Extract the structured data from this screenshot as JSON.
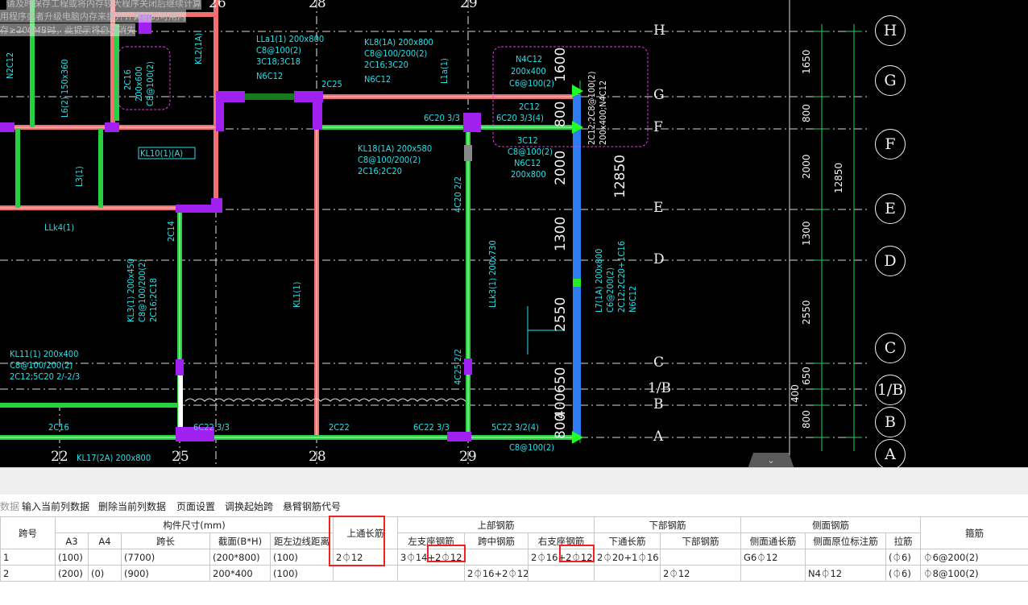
{
  "cad": {
    "warning_line1": "请及时保存工程或将内存较大程序关闭后继续计算",
    "warning_line2": "用程序或者升级电脑内存来提升计算机的可用内",
    "warning_line3": "存≥200MB时，此提示将自动消失",
    "axis_top": [
      "26",
      "28",
      "29"
    ],
    "axis_bottom": [
      "22",
      "25",
      "28",
      "29"
    ],
    "axis_rows": [
      "H",
      "G",
      "F",
      "E",
      "D",
      "C",
      "1/B",
      "B",
      "A"
    ],
    "axis_rows_plain": [
      "H",
      "G",
      "F",
      "E",
      "D",
      "C",
      "1/B",
      "B",
      "A"
    ],
    "dims_right": [
      "1650",
      "800",
      "2000",
      "1300",
      "2550",
      "650",
      "400",
      "800"
    ],
    "dim_total_right": "12850",
    "dims_mid": [
      "1600",
      "800",
      "2000",
      "1300",
      "2550",
      "650",
      "400",
      "800"
    ],
    "dim_total_mid": "12850",
    "labels": {
      "ll1": "LLa1(1) 200x800",
      "ll1b": "C8@100(2)",
      "ll1c": "3C18;3C18",
      "ll1d": "N6C12",
      "kl8": "KL8(1A) 200x800",
      "kl8b": "C8@100/200(2)",
      "kl8c": "2C16;3C20",
      "kl8d": "N6C12",
      "n4": "N4C12",
      "n4b": "200x400",
      "n4c": "C6@100(2)",
      "kl18": "KL18(1A) 200x580",
      "kl18b": "C8@100/200(2)",
      "kl18c": "2C16;2C20",
      "kl11": "KL11(1) 200x400",
      "kl11b": "C8@100/200(2)",
      "kl11c": "2C12;5C20 2/-2/3",
      "kl10": "KL10(1)(A)",
      "kl3": "KL3(1) 200x450",
      "kl3b": "C8@100/200(2)",
      "kl3c": "2C16;2C18",
      "lk4": "LLk4(1)",
      "l31": "L3(1)",
      "l62": "L6(2) 150x360",
      "kl17": "KL17(2A) 200x800",
      "c25a": "2C25",
      "c22": "2C22",
      "c16": "2C16",
      "c14": "2C14",
      "sixc22": "6C22 3/3",
      "sixc22b": "6C22 3/3",
      "fivec22": "5C22 3/2(4)",
      "sixc20": "6C20 3/3",
      "sixc20b": "6C20 3/3(4)",
      "c8_100": "C8@100(2)",
      "lk3": "LLk3(1) 200x730",
      "l7": "L7(1A) 200x800",
      "l7b": "C6@200(2)",
      "l7c": "2C12;2C20+1C16",
      "l7d": "N6C12",
      "kl1": "KL1(1)",
      "kl2": "KL2(1A)",
      "c12": "2C12",
      "c12b": "3C12",
      "c8b": "C8@100(2)",
      "n6": "N6C12",
      "size": "200x800",
      "c4": "4C25 2/2",
      "c20": "4C20 2/2",
      "l1a": "L1a(1)",
      "c2c16": "2C16",
      "c200x600": "200x600",
      "c8100": "C8@100(2)",
      "n2c12": "N2C12",
      "vert": "2C12;2C8@100(2)",
      "vert2": "200x400;N4C12"
    },
    "collapse_glyph": "⌄"
  },
  "toolbar": {
    "items": [
      "数据",
      "输入当前列数据",
      "删除当前列数据",
      "页面设置",
      "调换起始跨",
      "悬臂钢筋代号"
    ]
  },
  "table": {
    "h1": {
      "span": "跨号",
      "dims": "构件尺寸(mm)",
      "top_through": "上通长筋",
      "top_rebar": "上部钢筋",
      "bottom_rebar": "下部钢筋",
      "side_rebar": "侧面钢筋",
      "stirrup": "箍筋"
    },
    "h2": {
      "a3": "A3",
      "a4": "A4",
      "span_len": "跨长",
      "section": "截面(B*H)",
      "edge_dist": "距左边线距离",
      "left_support": "左支座钢筋",
      "mid_span": "跨中钢筋",
      "right_support": "右支座钢筋",
      "bottom_through": "下通长筋",
      "bottom": "下部钢筋",
      "side_through": "侧面通长筋",
      "side_mark": "侧面原位标注筋",
      "tie": "拉筋"
    },
    "rows": [
      {
        "span": "1",
        "a3": "(100)",
        "a4": "",
        "span_len": "(7700)",
        "section": "(200*800)",
        "edge_dist": "(100)",
        "top_through": "2⏀12",
        "left_support": "3⏀14+2⏀12",
        "mid_span": "",
        "right_support": "2⏀16+2⏀12",
        "bottom_through": "2⏀20+1⏀16",
        "bottom": "",
        "side_through": "G6⏀12",
        "side_mark": "",
        "tie": "(⏀6)",
        "stirrup": "⏀6@200(2)"
      },
      {
        "span": "2",
        "a3": "(200)",
        "a4": "(0)",
        "span_len": "(900)",
        "section": "200*400",
        "edge_dist": "(100)",
        "top_through": "",
        "left_support": "",
        "mid_span": "2⏀16+2⏀12",
        "right_support": "",
        "bottom_through": "",
        "bottom": "2⏀12",
        "side_through": "",
        "side_mark": "N4⏀12",
        "tie": "(⏀6)",
        "stirrup": "⏀8@100(2)"
      }
    ]
  }
}
